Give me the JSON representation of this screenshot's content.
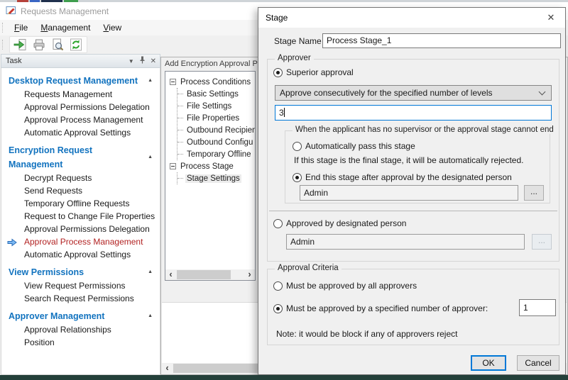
{
  "colors": {
    "section_header_blue": "#1273bf",
    "active_item_red": "#b22222",
    "focus_blue": "#0078d7",
    "tree_selection_gray": "#ececec",
    "bottom_strip_dark": "#24403a"
  },
  "icons": {
    "close": "✕",
    "panel_dropdown": "▼",
    "section_collapse": "▲",
    "scroll_left": "‹",
    "scroll_right": "›"
  },
  "main_window": {
    "title": "Requests Management",
    "menu": {
      "items": [
        "File",
        "Management",
        "View"
      ]
    }
  },
  "task_panel": {
    "title": "Task",
    "sections": [
      {
        "header": "Desktop Request Management",
        "items": [
          "Requests Management",
          "Approval Permissions Delegation",
          "Approval Process Management",
          "Automatic Approval Settings"
        ]
      },
      {
        "header": "Encryption Request Management",
        "items": [
          "Decrypt Requests",
          "Send Requests",
          "Temporary Offline Requests",
          "Request to Change File Properties",
          "Approval Permissions Delegation",
          "Approval Process Management",
          "Automatic Approval Settings"
        ],
        "active_item": "Approval Process Management"
      },
      {
        "header": "View Permissions",
        "items": [
          "View Request Permissions",
          "Search Request Permissions"
        ]
      },
      {
        "header": "Approver Management",
        "items": [
          "Approval Relationships",
          "Position"
        ]
      }
    ]
  },
  "process_window": {
    "title": "Add Encryption Approval Pro",
    "tree": {
      "roots": [
        {
          "label": "Process Conditions",
          "children": [
            "Basic Settings",
            "File Settings",
            "File Properties",
            "Outbound Recipien",
            "Outbound Configu",
            "Temporary Offline"
          ]
        },
        {
          "label": "Process Stage",
          "children": [
            "Stage Settings"
          ],
          "selected_child": "Stage Settings"
        }
      ]
    }
  },
  "stage_dialog": {
    "title": "Stage",
    "stage_name": {
      "label": "Stage Name",
      "value": "Process Stage_1"
    },
    "approver": {
      "group_label": "Approver",
      "superior_radio": "Superior approval",
      "mode_select_value": "Approve consecutively for the specified number of levels",
      "levels_value": "3",
      "fallback": {
        "group_label": "When the applicant has no supervisor or the approval stage cannot end",
        "auto_pass_radio": "Automatically pass this stage",
        "auto_pass_note": "If this stage is the final stage, it will be automatically rejected.",
        "end_stage_radio": "End this stage after approval by the designated person",
        "designee_value": "Admin",
        "browse_label": "..."
      },
      "designated_radio": "Approved by designated person",
      "designated_value": "Admin",
      "browse_label": "..."
    },
    "criteria": {
      "group_label": "Approval Criteria",
      "all_approvers_radio": "Must be approved by all approvers",
      "count_radio": "Must be approved by a specified number of approver:",
      "count_value": "1",
      "note": "Note: it would be block if any of approvers reject"
    },
    "ok_label": "OK",
    "cancel_label": "Cancel"
  }
}
